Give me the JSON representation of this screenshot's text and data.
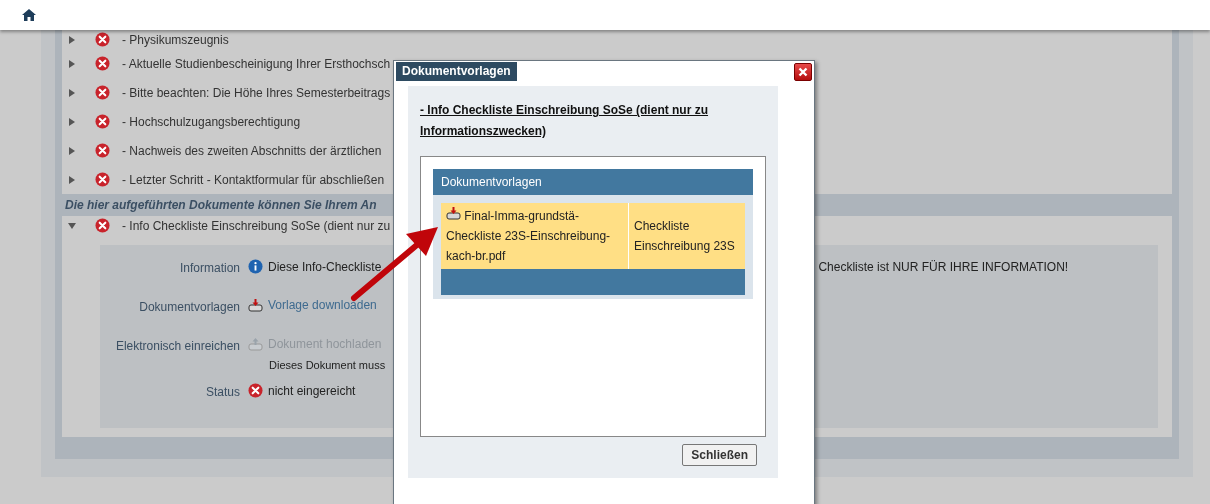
{
  "documents": [
    {
      "label": "- Physikumszeugnis",
      "expanded": false
    },
    {
      "label": "- Aktuelle Studienbescheinigung Ihrer Ersthochsch",
      "expanded": false
    },
    {
      "label": "- Bitte beachten: Die Höhe Ihres Semesterbeitrags",
      "expanded": false
    },
    {
      "label": "- Hochschulzugangsberechtigung",
      "expanded": false
    },
    {
      "label": "- Nachweis des zweiten Abschnitts der ärztlichen",
      "expanded": false
    },
    {
      "label": "- Letzter Schritt - Kontaktformular für abschließen",
      "expanded": false
    }
  ],
  "section_note": "Die hier aufgeführten Dokumente können Sie Ihrem An",
  "info_documents": [
    {
      "label": "- Info Checkliste Einschreibung SoSe (dient nur zu",
      "expanded": true,
      "details": [
        {
          "kind": "info",
          "label": "Information",
          "text": "Diese Info-Checkliste",
          "text_right": "Checkliste ist NUR FÜR IHRE INFORMATION!"
        },
        {
          "kind": "link",
          "label": "Dokumentvorlagen",
          "link": "Vorlage downloaden",
          "disabled": false
        },
        {
          "kind": "link",
          "label": "Elektronisch einreichen",
          "link": "Dokument hochladen",
          "disabled": true,
          "note": "Dieses Dokument muss"
        },
        {
          "kind": "status",
          "label": "Status",
          "text": "nicht eingereicht"
        }
      ]
    }
  ],
  "dialog": {
    "title": "Dokumentvorlagen",
    "heading": "- Info Checkliste Einschreibung SoSe (dient nur zu Informationszwecken)",
    "table": {
      "header": "Dokumentvorlagen",
      "rows": [
        {
          "file": "Final-Imma-grundstä-Checkliste 23S-Einschreibung-kach-br.pdf",
          "description": "Checkliste Einschreibung 23S"
        }
      ]
    },
    "close_button": "Schließen"
  }
}
